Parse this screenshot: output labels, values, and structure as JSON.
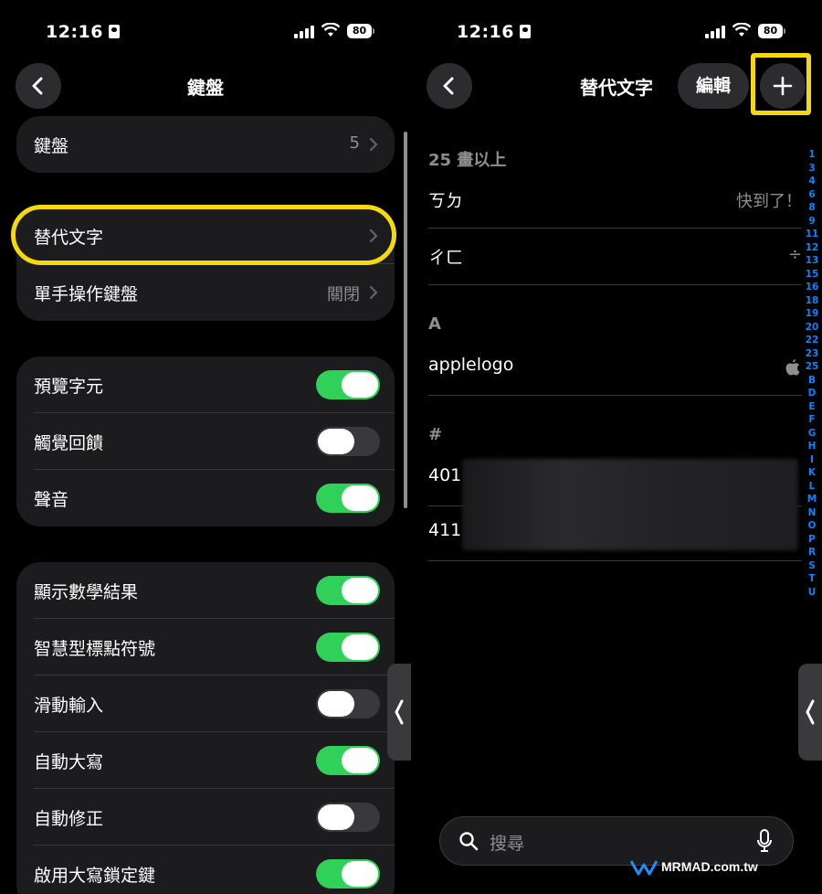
{
  "left": {
    "status": {
      "time": "12:16",
      "battery": "80"
    },
    "nav": {
      "title": "鍵盤"
    },
    "group1": [
      {
        "label": "鍵盤",
        "value": "5"
      }
    ],
    "group2": [
      {
        "label": "替代文字",
        "value": ""
      },
      {
        "label": "單手操作鍵盤",
        "value": "關閉"
      }
    ],
    "group3": [
      {
        "label": "預覽字元",
        "on": true
      },
      {
        "label": "觸覺回饋",
        "on": false
      },
      {
        "label": "聲音",
        "on": true
      }
    ],
    "group4": [
      {
        "label": "顯示數學結果",
        "on": true
      },
      {
        "label": "智慧型標點符號",
        "on": true
      },
      {
        "label": "滑動輸入",
        "on": false
      },
      {
        "label": "自動大寫",
        "on": true
      },
      {
        "label": "自動修正",
        "on": false
      },
      {
        "label": "啟用大寫鎖定鍵",
        "on": true
      }
    ]
  },
  "right": {
    "status": {
      "time": "12:16",
      "battery": "80"
    },
    "nav": {
      "title": "替代文字",
      "edit_label": "編輯"
    },
    "sections": [
      {
        "header": "25 畫以上",
        "rows": [
          {
            "phrase": "ㄎㄉ",
            "shortcut": "快到了！"
          },
          {
            "phrase": "ㄔㄈ",
            "shortcut": "÷"
          }
        ]
      },
      {
        "header": "A",
        "rows": [
          {
            "phrase": "applelogo",
            "shortcut": "apple-logo-icon"
          }
        ]
      },
      {
        "header": "#",
        "rows": [
          {
            "phrase": "401",
            "shortcut": ""
          },
          {
            "phrase": "411",
            "shortcut": ""
          }
        ]
      }
    ],
    "index": [
      "1",
      "3",
      "4",
      "6",
      "8",
      "9",
      "11",
      "12",
      "13",
      "15",
      "16",
      "18",
      "19",
      "20",
      "22",
      "23",
      "25",
      "B",
      "D",
      "E",
      "F",
      "G",
      "H",
      "I",
      "K",
      "L",
      "M",
      "N",
      "O",
      "P",
      "R",
      "S",
      "T",
      "U"
    ],
    "search": {
      "placeholder": "搜尋"
    }
  },
  "watermark": "MRMAD.com.tw",
  "colors": {
    "accent": "#0a84ff",
    "toggle_on": "#30d158",
    "highlight": "#f5d90a"
  }
}
